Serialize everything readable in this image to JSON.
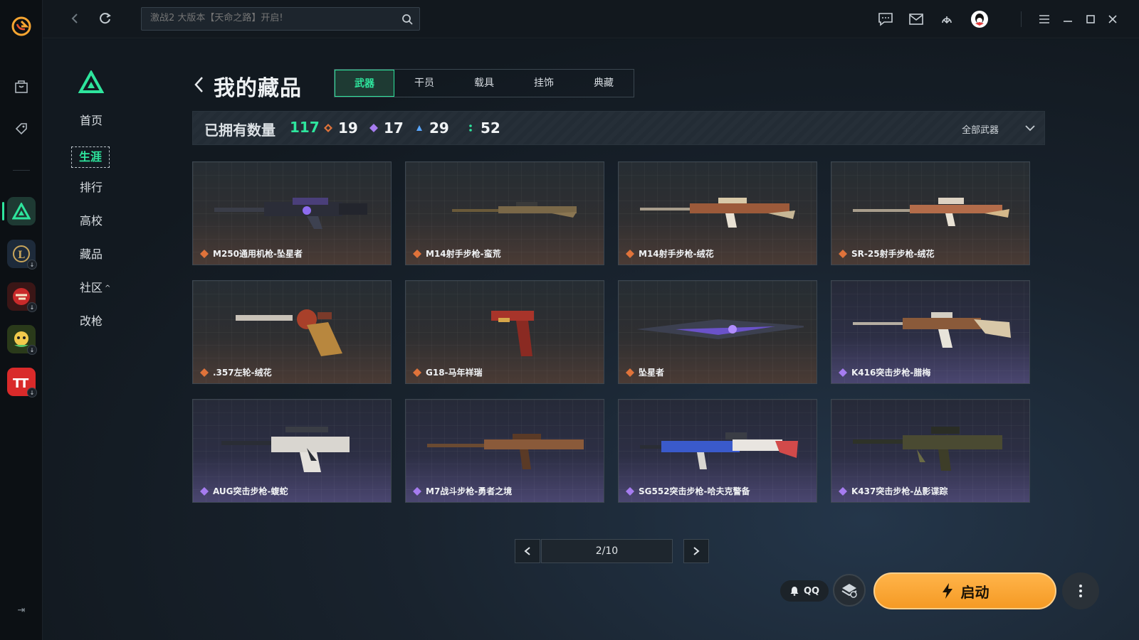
{
  "topbar": {
    "search_placeholder": "激战2 大版本【天命之路】开启!"
  },
  "sidebar": {
    "items": [
      {
        "label": "首页"
      },
      {
        "label": "生涯",
        "active": true
      },
      {
        "label": "排行"
      },
      {
        "label": "高校"
      },
      {
        "label": "藏品"
      },
      {
        "label": "社区",
        "caret": "^"
      },
      {
        "label": "改枪"
      }
    ]
  },
  "header": {
    "title": "我的藏品",
    "tabs": [
      {
        "label": "武器",
        "active": true
      },
      {
        "label": "干员"
      },
      {
        "label": "载具"
      },
      {
        "label": "挂饰"
      },
      {
        "label": "典藏"
      }
    ]
  },
  "stats": {
    "owned_label": "已拥有数量",
    "owned_count": "117",
    "rarities": [
      {
        "count": "19",
        "color": "#e0733a"
      },
      {
        "count": "17",
        "color": "#a67cf0"
      },
      {
        "count": "29",
        "color": "#5aa7ff"
      },
      {
        "count": "52",
        "color": "#2ee59d"
      }
    ],
    "filter_label": "全部武器"
  },
  "items": [
    {
      "name": "M250通用机枪-坠星者",
      "rarity": "orange"
    },
    {
      "name": "M14射手步枪-蛮荒",
      "rarity": "orange"
    },
    {
      "name": "M14射手步枪-绒花",
      "rarity": "orange"
    },
    {
      "name": "SR-25射手步枪-绒花",
      "rarity": "orange"
    },
    {
      "name": ".357左轮-绒花",
      "rarity": "orange"
    },
    {
      "name": "G18-马年祥瑞",
      "rarity": "orange"
    },
    {
      "name": "坠星者",
      "rarity": "orange"
    },
    {
      "name": "K416突击步枪-腊梅",
      "rarity": "purple"
    },
    {
      "name": "AUG突击步枪-蝮蛇",
      "rarity": "purple"
    },
    {
      "name": "M7战斗步枪-勇者之境",
      "rarity": "purple"
    },
    {
      "name": "SG552突击步枪-哈夫克警备",
      "rarity": "purple"
    },
    {
      "name": "K437突击步枪-丛影谍踪",
      "rarity": "purple"
    }
  ],
  "pagination": {
    "current": "2/10"
  },
  "footer": {
    "qq_label": "QQ",
    "launch_label": "启动"
  },
  "colors": {
    "accent": "#2ee59d",
    "launch": "#f59a24",
    "rarity_orange": "#e0733a",
    "rarity_purple": "#a67cf0"
  }
}
